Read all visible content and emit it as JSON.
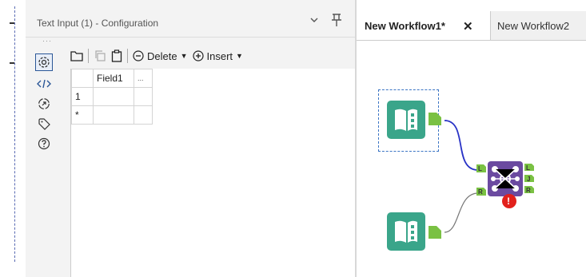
{
  "config_panel": {
    "title": "Text Input (1) - Configuration",
    "toolbar": {
      "delete_label": "Delete",
      "insert_label": "Insert"
    },
    "grid": {
      "headers": [
        "Field1",
        "..."
      ],
      "rows": [
        {
          "row_label": "1",
          "value": ""
        },
        {
          "row_label": "*",
          "value": ""
        }
      ]
    },
    "side_icons": [
      "gear-icon",
      "code-icon",
      "annotation-icon",
      "tag-icon",
      "help-icon"
    ]
  },
  "canvas": {
    "tabs": [
      {
        "label": "New Workflow1*",
        "active": true,
        "close": "✕"
      },
      {
        "label": "New Workflow2",
        "active": false
      }
    ],
    "join_tool": {
      "left_anchor": "L",
      "join_anchor": "J",
      "right_anchor": "R",
      "input_left": "L",
      "input_right": "R",
      "error_badge": "!"
    }
  },
  "colors": {
    "book_icon": "#3aa58a",
    "join_icon": "#6b4aa0",
    "anchor_green": "#7ac143",
    "error_red": "#e2211c",
    "connector_blue": "#2933c6",
    "connector_gray": "#777777"
  }
}
